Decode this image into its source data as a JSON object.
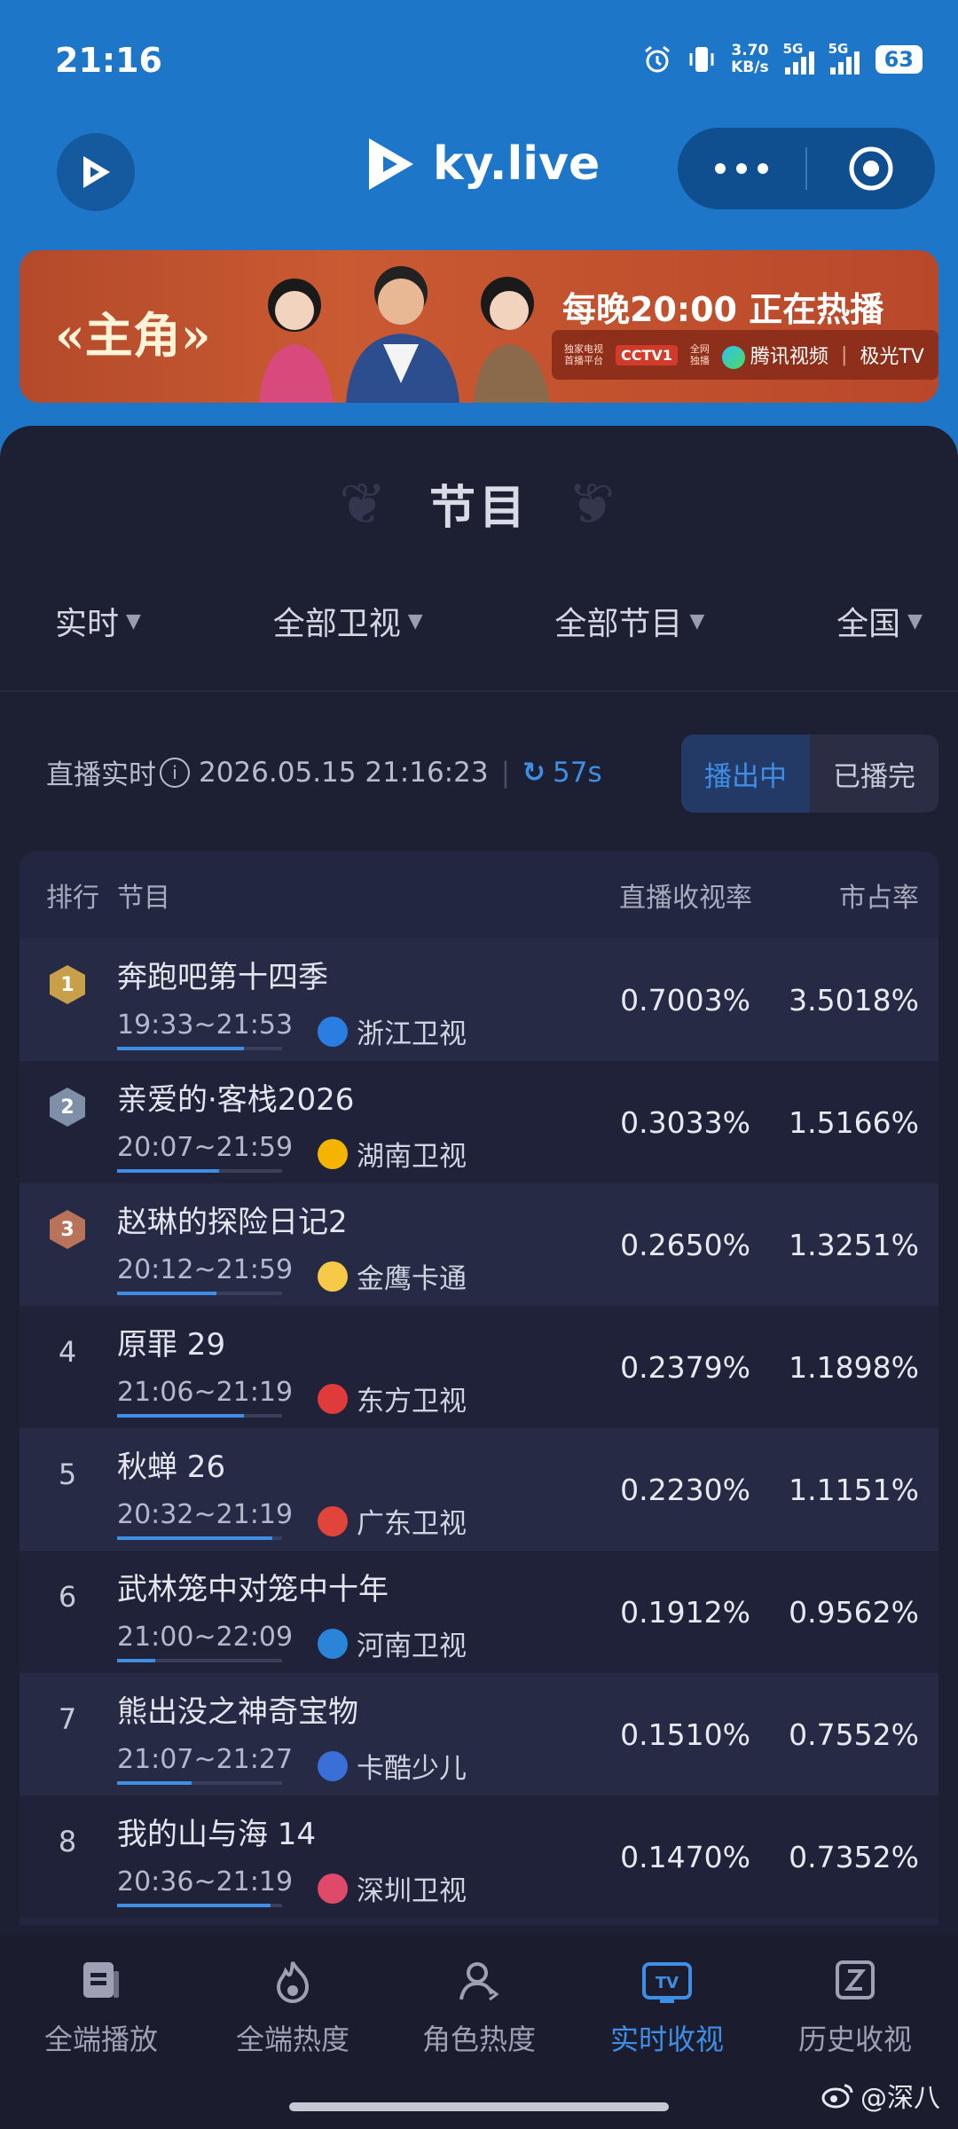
{
  "status_bar": {
    "time": "21:16",
    "net_speed_value": "3.70",
    "net_speed_unit": "KB/s",
    "sim1": "5G",
    "sim2": "5G",
    "battery": "63"
  },
  "header": {
    "brand": "ky.live",
    "left_icon": "play-logo-icon",
    "more_icon": "more-dots-icon",
    "record_icon": "target-icon"
  },
  "banner": {
    "show_title": "«主角»",
    "slogan": "每晚20:00 正在热播",
    "partner_note_1": "独家电视",
    "partner_note_2": "首播平台",
    "cctv": "CCTV1",
    "partner_note_3": "全网",
    "partner_note_4": "独播",
    "tencent": "腾讯视频",
    "jiguang": "极光TV"
  },
  "panel": {
    "title": "节目",
    "filters": [
      "实时",
      "全部卫视",
      "全部节目",
      "全国"
    ],
    "live_label": "直播实时",
    "datetime": "2026.05.15 21:16:23",
    "countdown": "57s",
    "segment_on": "播出中",
    "segment_off": "已播完"
  },
  "table": {
    "headers": {
      "rank": "排行",
      "program": "节目",
      "rating": "直播收视率",
      "share": "市占率"
    },
    "rows": [
      {
        "rank": "1",
        "medal": "gold",
        "name": "奔跑吧第十四季",
        "time": "19:33~21:53",
        "channel": "浙江卫视",
        "channel_color": "#2a7de1",
        "rating": "0.7003%",
        "share": "3.5018%",
        "progress": 0.77
      },
      {
        "rank": "2",
        "medal": "silver",
        "name": "亲爱的·客栈2026",
        "time": "20:07~21:59",
        "channel": "湖南卫视",
        "channel_color": "#f4b400",
        "rating": "0.3033%",
        "share": "1.5166%",
        "progress": 0.62
      },
      {
        "rank": "3",
        "medal": "bronze",
        "name": "赵琳的探险日记2",
        "time": "20:12~21:59",
        "channel": "金鹰卡通",
        "channel_color": "#f7c948",
        "rating": "0.2650%",
        "share": "1.3251%",
        "progress": 0.6
      },
      {
        "rank": "4",
        "medal": "",
        "name": "原罪 29",
        "time": "21:06~21:19",
        "channel": "东方卫视",
        "channel_color": "#e03a3a",
        "rating": "0.2379%",
        "share": "1.1898%",
        "progress": 0.77
      },
      {
        "rank": "5",
        "medal": "",
        "name": "秋蝉 26",
        "time": "20:32~21:19",
        "channel": "广东卫视",
        "channel_color": "#e0443a",
        "rating": "0.2230%",
        "share": "1.1151%",
        "progress": 0.94
      },
      {
        "rank": "6",
        "medal": "",
        "name": "武林笼中对笼中十年",
        "time": "21:00~22:09",
        "channel": "河南卫视",
        "channel_color": "#2a84d8",
        "rating": "0.1912%",
        "share": "0.9562%",
        "progress": 0.23
      },
      {
        "rank": "7",
        "medal": "",
        "name": "熊出没之神奇宝物",
        "time": "21:07~21:27",
        "channel": "卡酷少儿",
        "channel_color": "#3a6fd8",
        "rating": "0.1510%",
        "share": "0.7552%",
        "progress": 0.45
      },
      {
        "rank": "8",
        "medal": "",
        "name": "我的山与海 14",
        "time": "20:36~21:19",
        "channel": "深圳卫视",
        "channel_color": "#e04a6a",
        "rating": "0.1470%",
        "share": "0.7352%",
        "progress": 0.93
      }
    ]
  },
  "tabbar": {
    "tabs": [
      {
        "label": "全端播放",
        "icon": "tv-screen-icon"
      },
      {
        "label": "全端热度",
        "icon": "flame-icon"
      },
      {
        "label": "角色热度",
        "icon": "person-icon"
      },
      {
        "label": "实时收视",
        "icon": "live-tv-icon",
        "active": true
      },
      {
        "label": "历史收视",
        "icon": "history-icon"
      }
    ]
  },
  "watermark_text": "@深八",
  "colors": {
    "accent": "#3f8ee6",
    "header_blue": "#1e76c9",
    "panel_bg": "#1d1f33",
    "gold": "#c9a04a",
    "silver": "#7f8fa8",
    "bronze": "#b8735a"
  }
}
